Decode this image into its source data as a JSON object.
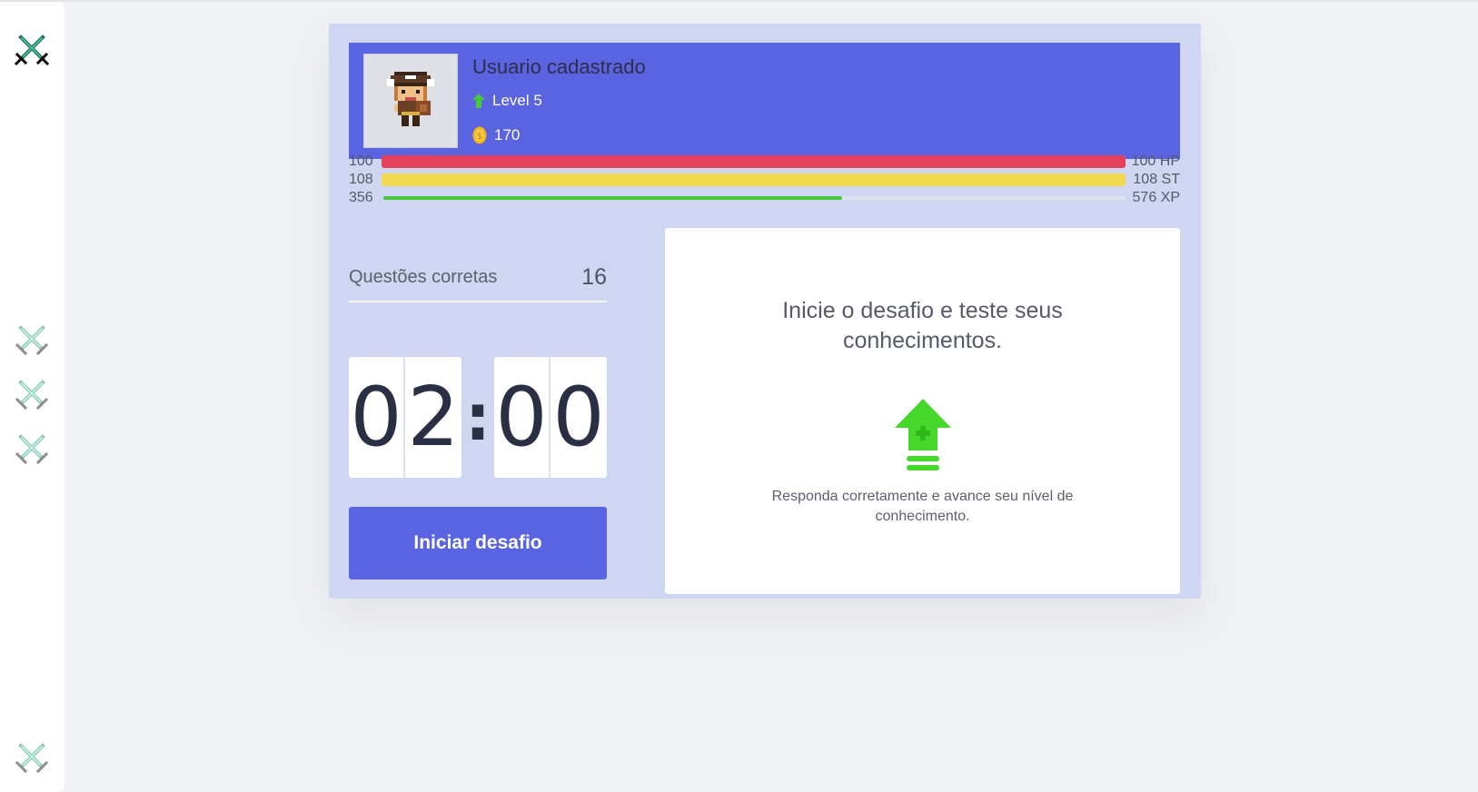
{
  "sidebar": {
    "items": [
      {
        "icon": "crossed-swords-icon",
        "active": true
      },
      {
        "icon": "crossed-swords-icon",
        "active": false
      },
      {
        "icon": "crossed-swords-icon",
        "active": false
      },
      {
        "icon": "crossed-swords-icon",
        "active": false
      },
      {
        "icon": "crossed-swords-icon",
        "active": false
      }
    ]
  },
  "profile": {
    "username": "Usuario cadastrado",
    "level_label": "Level 5",
    "coins": "170",
    "avatar_icon": "pixel-pirate-avatar"
  },
  "stats": {
    "hp": {
      "current": "100",
      "max_label": "100 HP",
      "fraction": 1.0,
      "color": "#e2405b"
    },
    "st": {
      "current": "108",
      "max_label": "108 ST",
      "fraction": 1.0,
      "color": "#f0da50"
    },
    "xp": {
      "current": "356",
      "max_label": "576 XP",
      "fraction": 0.618,
      "color": "#46c93a"
    }
  },
  "quiz": {
    "correct_label": "Questões corretas",
    "correct_value": "16",
    "timer": {
      "m1": "0",
      "m2": "2",
      "sep": ":",
      "s1": "0",
      "s2": "0"
    },
    "start_label": "Iniciar desafio"
  },
  "challenge": {
    "title": "Inicie o desafio e teste seus conhecimentos.",
    "icon": "level-up-arrow-icon",
    "description": "Responda corretamente e avance seu nível de conhecimento."
  },
  "colors": {
    "accent": "#5a64e1",
    "card_bg": "#cfd6f2",
    "page_bg": "#f0f1f4",
    "green": "#46c93a"
  }
}
